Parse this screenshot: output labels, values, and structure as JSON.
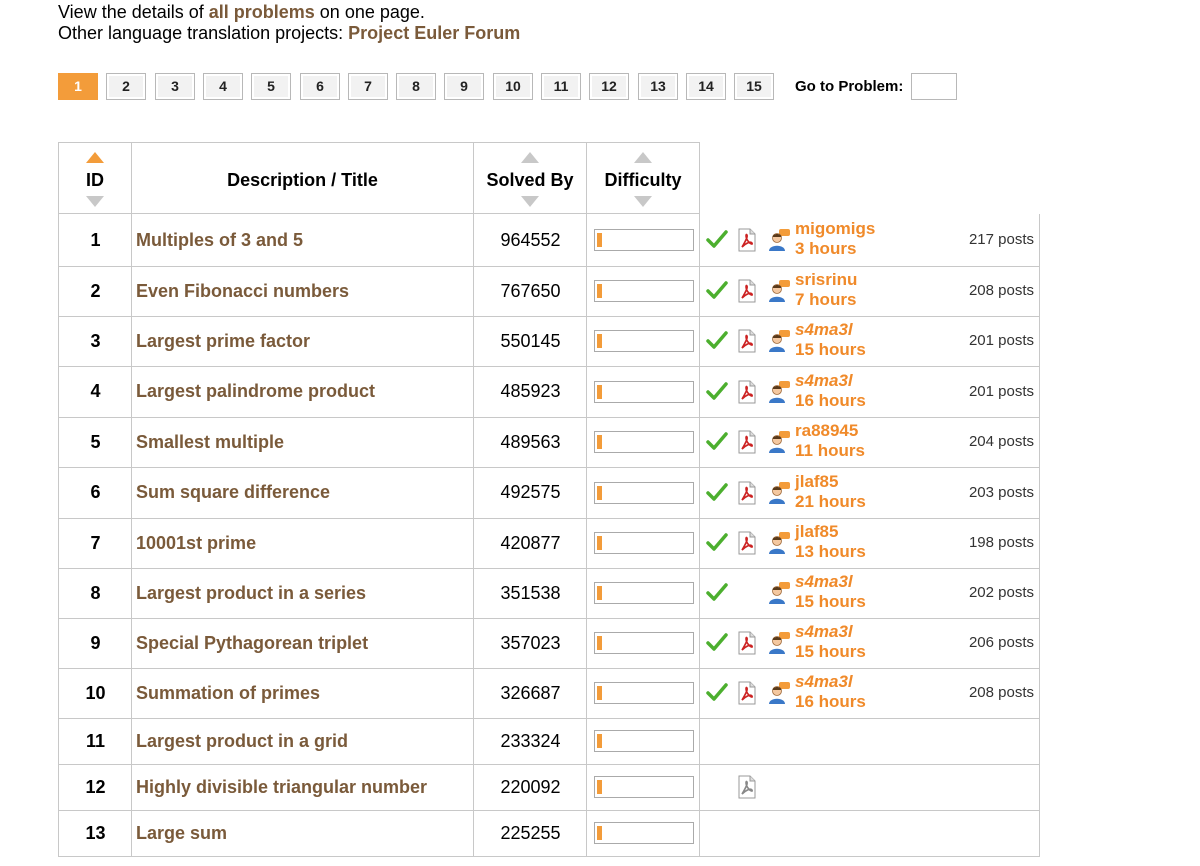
{
  "intro": {
    "line1_pre": "View the details of ",
    "line1_link": "all problems",
    "line1_post": " on one page.",
    "line2_pre": "Other language translation projects: ",
    "line2_link": "Project Euler Forum"
  },
  "pager": {
    "pages": [
      "1",
      "2",
      "3",
      "4",
      "5",
      "6",
      "7",
      "8",
      "9",
      "10",
      "11",
      "12",
      "13",
      "14",
      "15"
    ],
    "active": "1",
    "goto_label": "Go to Problem:",
    "goto_value": ""
  },
  "columns": {
    "id": "ID",
    "title": "Description / Title",
    "solved": "Solved By",
    "difficulty": "Difficulty"
  },
  "colors": {
    "accent": "#f39c3a",
    "title_link": "#7a5a3a",
    "user": "#f08a2a",
    "check": "#4caf2e",
    "pdf": "#cc2222"
  },
  "rows": [
    {
      "id": "1",
      "title": "Multiples of 3 and 5",
      "solved": "964552",
      "difficulty": 0.05,
      "check": true,
      "pdf": true,
      "user": true,
      "user_name": "migomigs",
      "user_time": "3 hours",
      "italic": false,
      "posts": "217 posts"
    },
    {
      "id": "2",
      "title": "Even Fibonacci numbers",
      "solved": "767650",
      "difficulty": 0.05,
      "check": true,
      "pdf": true,
      "user": true,
      "user_name": "srisrinu",
      "user_time": "7 hours",
      "italic": false,
      "posts": "208 posts"
    },
    {
      "id": "3",
      "title": "Largest prime factor",
      "solved": "550145",
      "difficulty": 0.05,
      "check": true,
      "pdf": true,
      "user": true,
      "user_name": "s4ma3l",
      "user_time": "15 hours",
      "italic": true,
      "posts": "201 posts"
    },
    {
      "id": "4",
      "title": "Largest palindrome product",
      "solved": "485923",
      "difficulty": 0.05,
      "check": true,
      "pdf": true,
      "user": true,
      "user_name": "s4ma3l",
      "user_time": "16 hours",
      "italic": true,
      "posts": "201 posts"
    },
    {
      "id": "5",
      "title": "Smallest multiple",
      "solved": "489563",
      "difficulty": 0.05,
      "check": true,
      "pdf": true,
      "user": true,
      "user_name": "ra88945",
      "user_time": "11 hours",
      "italic": false,
      "posts": "204 posts"
    },
    {
      "id": "6",
      "title": "Sum square difference",
      "solved": "492575",
      "difficulty": 0.05,
      "check": true,
      "pdf": true,
      "user": true,
      "user_name": "jlaf85",
      "user_time": "21 hours",
      "italic": false,
      "posts": "203 posts"
    },
    {
      "id": "7",
      "title": "10001st prime",
      "solved": "420877",
      "difficulty": 0.05,
      "check": true,
      "pdf": true,
      "user": true,
      "user_name": "jlaf85",
      "user_time": "13 hours",
      "italic": false,
      "posts": "198 posts"
    },
    {
      "id": "8",
      "title": "Largest product in a series",
      "solved": "351538",
      "difficulty": 0.05,
      "check": true,
      "pdf": false,
      "user": true,
      "user_name": "s4ma3l",
      "user_time": "15 hours",
      "italic": true,
      "posts": "202 posts"
    },
    {
      "id": "9",
      "title": "Special Pythagorean triplet",
      "solved": "357023",
      "difficulty": 0.05,
      "check": true,
      "pdf": true,
      "user": true,
      "user_name": "s4ma3l",
      "user_time": "15 hours",
      "italic": true,
      "posts": "206 posts"
    },
    {
      "id": "10",
      "title": "Summation of primes",
      "solved": "326687",
      "difficulty": 0.05,
      "check": true,
      "pdf": true,
      "user": true,
      "user_name": "s4ma3l",
      "user_time": "16 hours",
      "italic": true,
      "posts": "208 posts"
    },
    {
      "id": "11",
      "title": "Largest product in a grid",
      "solved": "233324",
      "difficulty": 0.05,
      "check": false,
      "pdf": false,
      "user": false,
      "user_name": "",
      "user_time": "",
      "italic": false,
      "posts": ""
    },
    {
      "id": "12",
      "title": "Highly divisible triangular number",
      "solved": "220092",
      "difficulty": 0.05,
      "check": false,
      "pdf": true,
      "pdf_gray": true,
      "user": false,
      "user_name": "",
      "user_time": "",
      "italic": false,
      "posts": ""
    },
    {
      "id": "13",
      "title": "Large sum",
      "solved": "225255",
      "difficulty": 0.05,
      "check": false,
      "pdf": false,
      "user": false,
      "user_name": "",
      "user_time": "",
      "italic": false,
      "posts": ""
    }
  ]
}
